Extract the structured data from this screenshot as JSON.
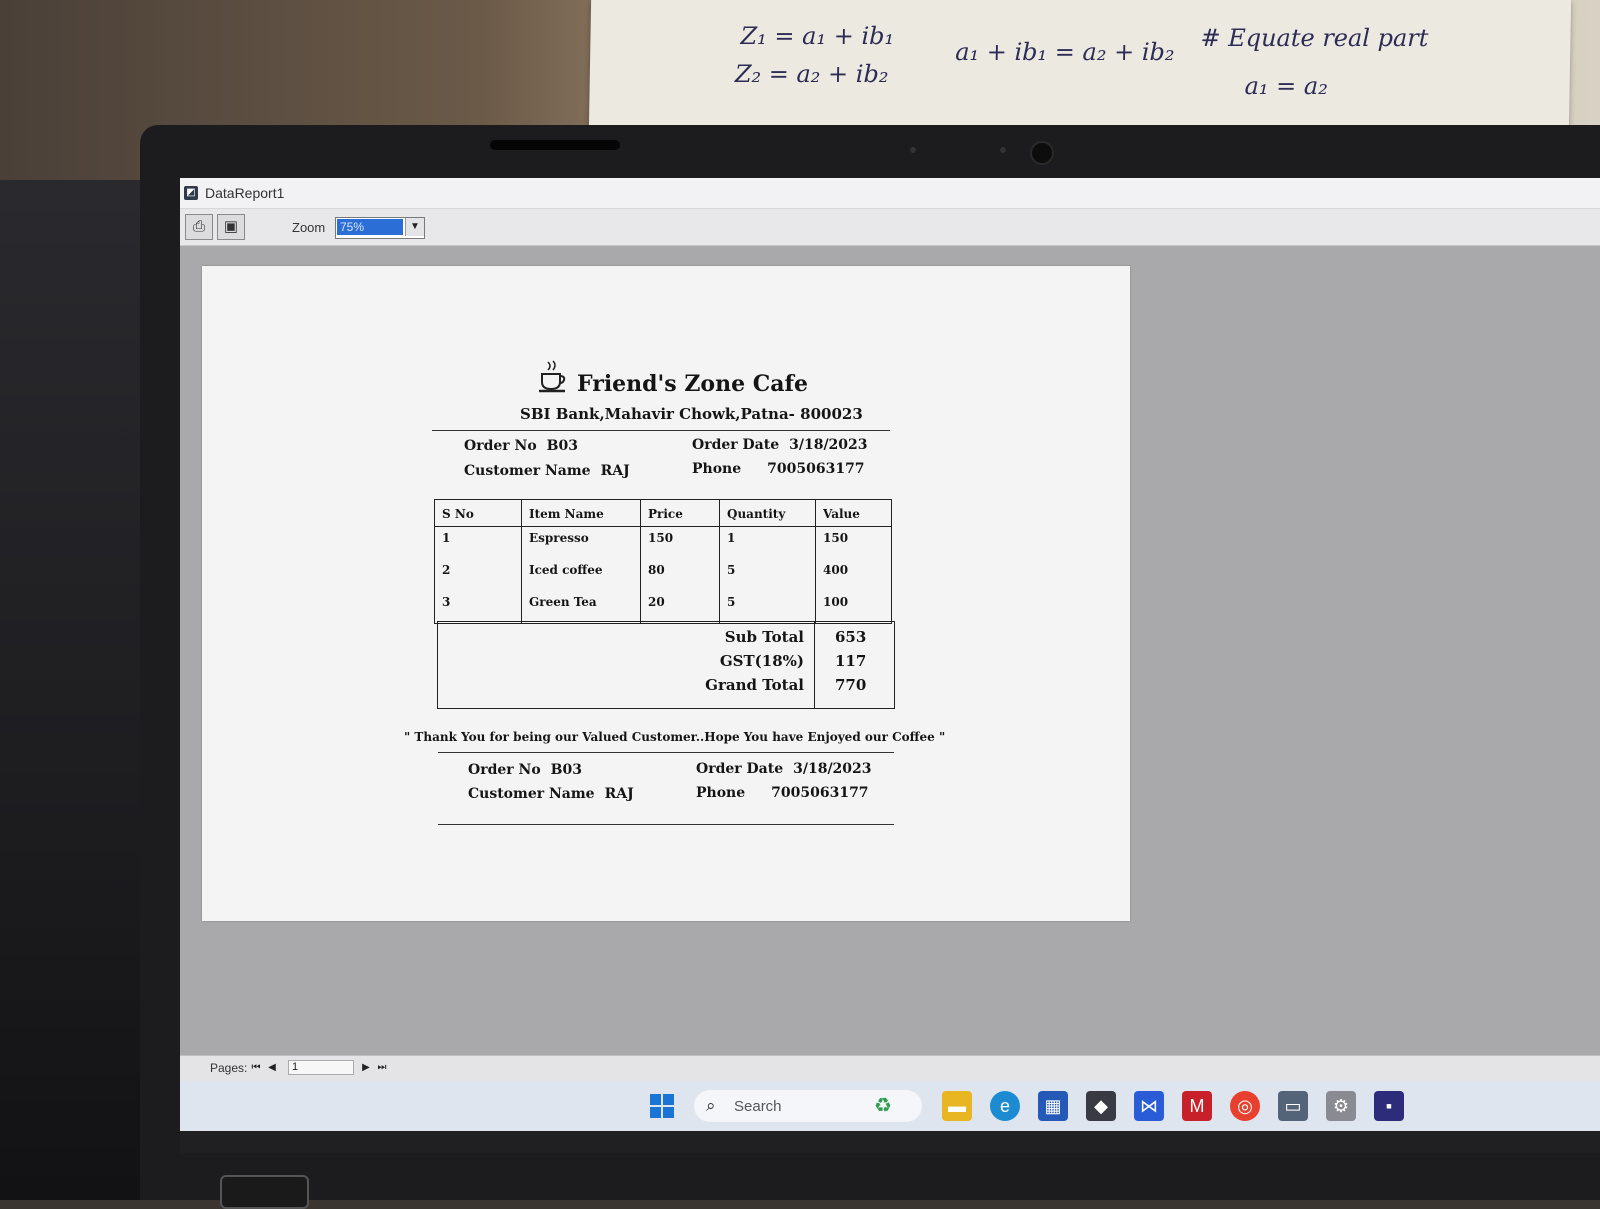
{
  "background_note": {
    "line1": "Z₁ = a₁ + ib₁",
    "line2": "Z₂ = a₂ + ib₂",
    "equation": "a₁ + ib₁ = a₂ + ib₂",
    "comment": "# Equate real part",
    "result": "a₁ = a₂"
  },
  "window": {
    "title": "DataReport1",
    "toolbar": {
      "zoom_label": "Zoom",
      "zoom_value": "75%"
    }
  },
  "report": {
    "shop_name": "Friend's Zone Cafe",
    "address": "SBI Bank,Mahavir Chowk,Patna- 800023",
    "header": {
      "order_no_label": "Order No",
      "order_no": "B03",
      "order_date_label": "Order Date",
      "order_date": "3/18/2023",
      "customer_label": "Customer Name",
      "customer": "RAJ",
      "phone_label": "Phone",
      "phone": "7005063177"
    },
    "columns": [
      "S No",
      "Item Name",
      "Price",
      "Quantity",
      "Value"
    ],
    "items": [
      [
        "1",
        "Espresso",
        "150",
        "1",
        "150"
      ],
      [
        "2",
        "Iced coffee",
        "80",
        "5",
        "400"
      ],
      [
        "3",
        "Green Tea",
        "20",
        "5",
        "100"
      ]
    ],
    "totals": {
      "subtotal_label": "Sub Total",
      "subtotal": "653",
      "gst_label": "GST(18%)",
      "gst": "117",
      "grand_label": "Grand Total",
      "grand": "770"
    },
    "thanks": "\" Thank You for being our Valued Customer..Hope You have Enjoyed our Coffee \"",
    "footer": {
      "order_no_label": "Order No",
      "order_no": "B03",
      "order_date_label": "Order Date",
      "order_date": "3/18/2023",
      "customer_label": "Customer Name",
      "customer": "RAJ",
      "phone_label": "Phone",
      "phone": "7005063177"
    }
  },
  "pager": {
    "label": "Pages:",
    "page": "1"
  },
  "taskbar": {
    "search_placeholder": "Search",
    "icons": [
      "windows-start-icon",
      "search-icon",
      "file-explorer-icon",
      "edge-icon",
      "store-icon",
      "app-icon",
      "visual-studio-icon",
      "mcafee-icon",
      "chrome-icon",
      "terminal-icon",
      "network-icon",
      "vb-app-icon"
    ]
  }
}
